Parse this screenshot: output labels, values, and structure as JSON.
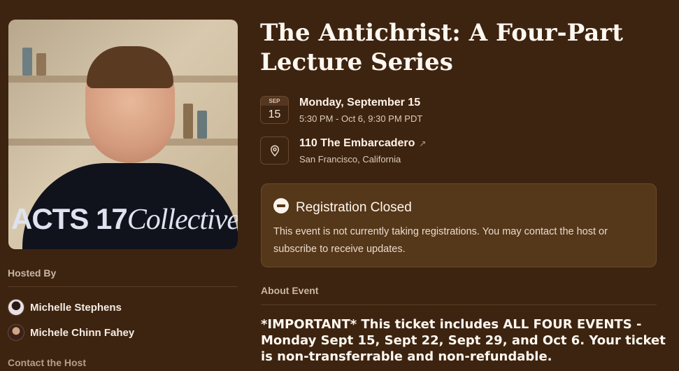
{
  "cover": {
    "logo_main": "ACTS 17",
    "logo_script": "Collective"
  },
  "event": {
    "title": "The Antichrist: A Four-Part Lecture Series",
    "date_badge": {
      "month": "SEP",
      "day": "15"
    },
    "date_main": "Monday, September 15",
    "time_range": "5:30 PM - Oct 6, 9:30 PM PDT",
    "location_main": "110 The Embarcadero",
    "location_arrow": "↗",
    "location_sub": "San Francisco, California",
    "location_icon": "map-pin-icon"
  },
  "registration": {
    "icon": "no-entry-icon",
    "title": "Registration Closed",
    "body": "This event is not currently taking registrations. You may contact the host or subscribe to receive updates."
  },
  "hosts": {
    "label": "Hosted By",
    "items": [
      {
        "name": "Michelle Stephens"
      },
      {
        "name": "Michele Chinn Fahey"
      }
    ],
    "contact_label": "Contact the Host"
  },
  "about": {
    "label": "About Event",
    "important_text": "*IMPORTANT* This ticket includes ALL FOUR EVENTS - Monday Sept 15, Sept 22, Sept 29, and Oct 6. Your ticket is non-transferrable and non-refundable."
  },
  "colors": {
    "background": "#3d2410",
    "card": "#553719",
    "text": "#f4ece4"
  }
}
